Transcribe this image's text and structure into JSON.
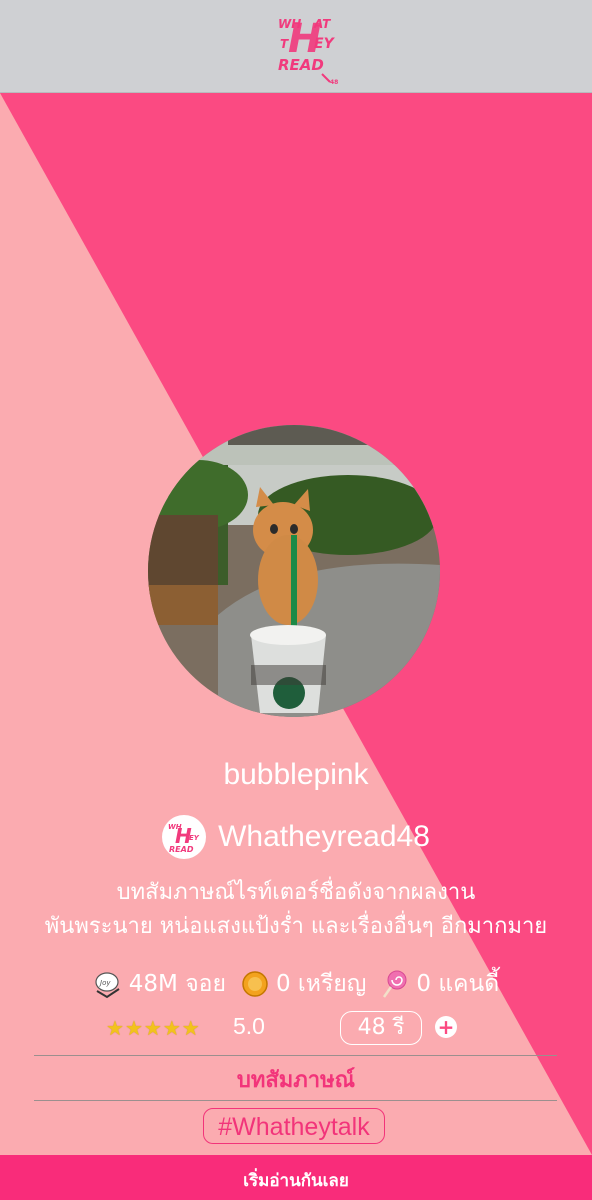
{
  "header": {
    "logo_name": "whatheyread-logo"
  },
  "profile": {
    "username": "bubblepink",
    "source_name": "Whatheyread48",
    "description_line1": "บทสัมภาษณ์ไรท์เตอร์ชื่อดังจากผลงาน",
    "description_line2": "พันพระนาย หน่อแสงแป้งร่ำ และเรื่องอื่นๆ อีกมากมาย"
  },
  "stats": {
    "joy_value": "48M จอย",
    "coin_value": "0 เหรียญ",
    "candy_value": "0 แคนดี้"
  },
  "rating": {
    "stars_count": 5,
    "star_glyph": "★",
    "value": "5.0",
    "episodes": "48 รี",
    "add_symbol": "+"
  },
  "category": "บทสัมภาษณ์",
  "hashtag": "#Whatheytalk",
  "start_button": "เริ่มอ่านกันเลย",
  "colors": {
    "pink": "#fb4a82",
    "peach": "#fbabb0",
    "topbar_gray": "#cfd0d3",
    "bottom_pink": "#f92c7a"
  }
}
